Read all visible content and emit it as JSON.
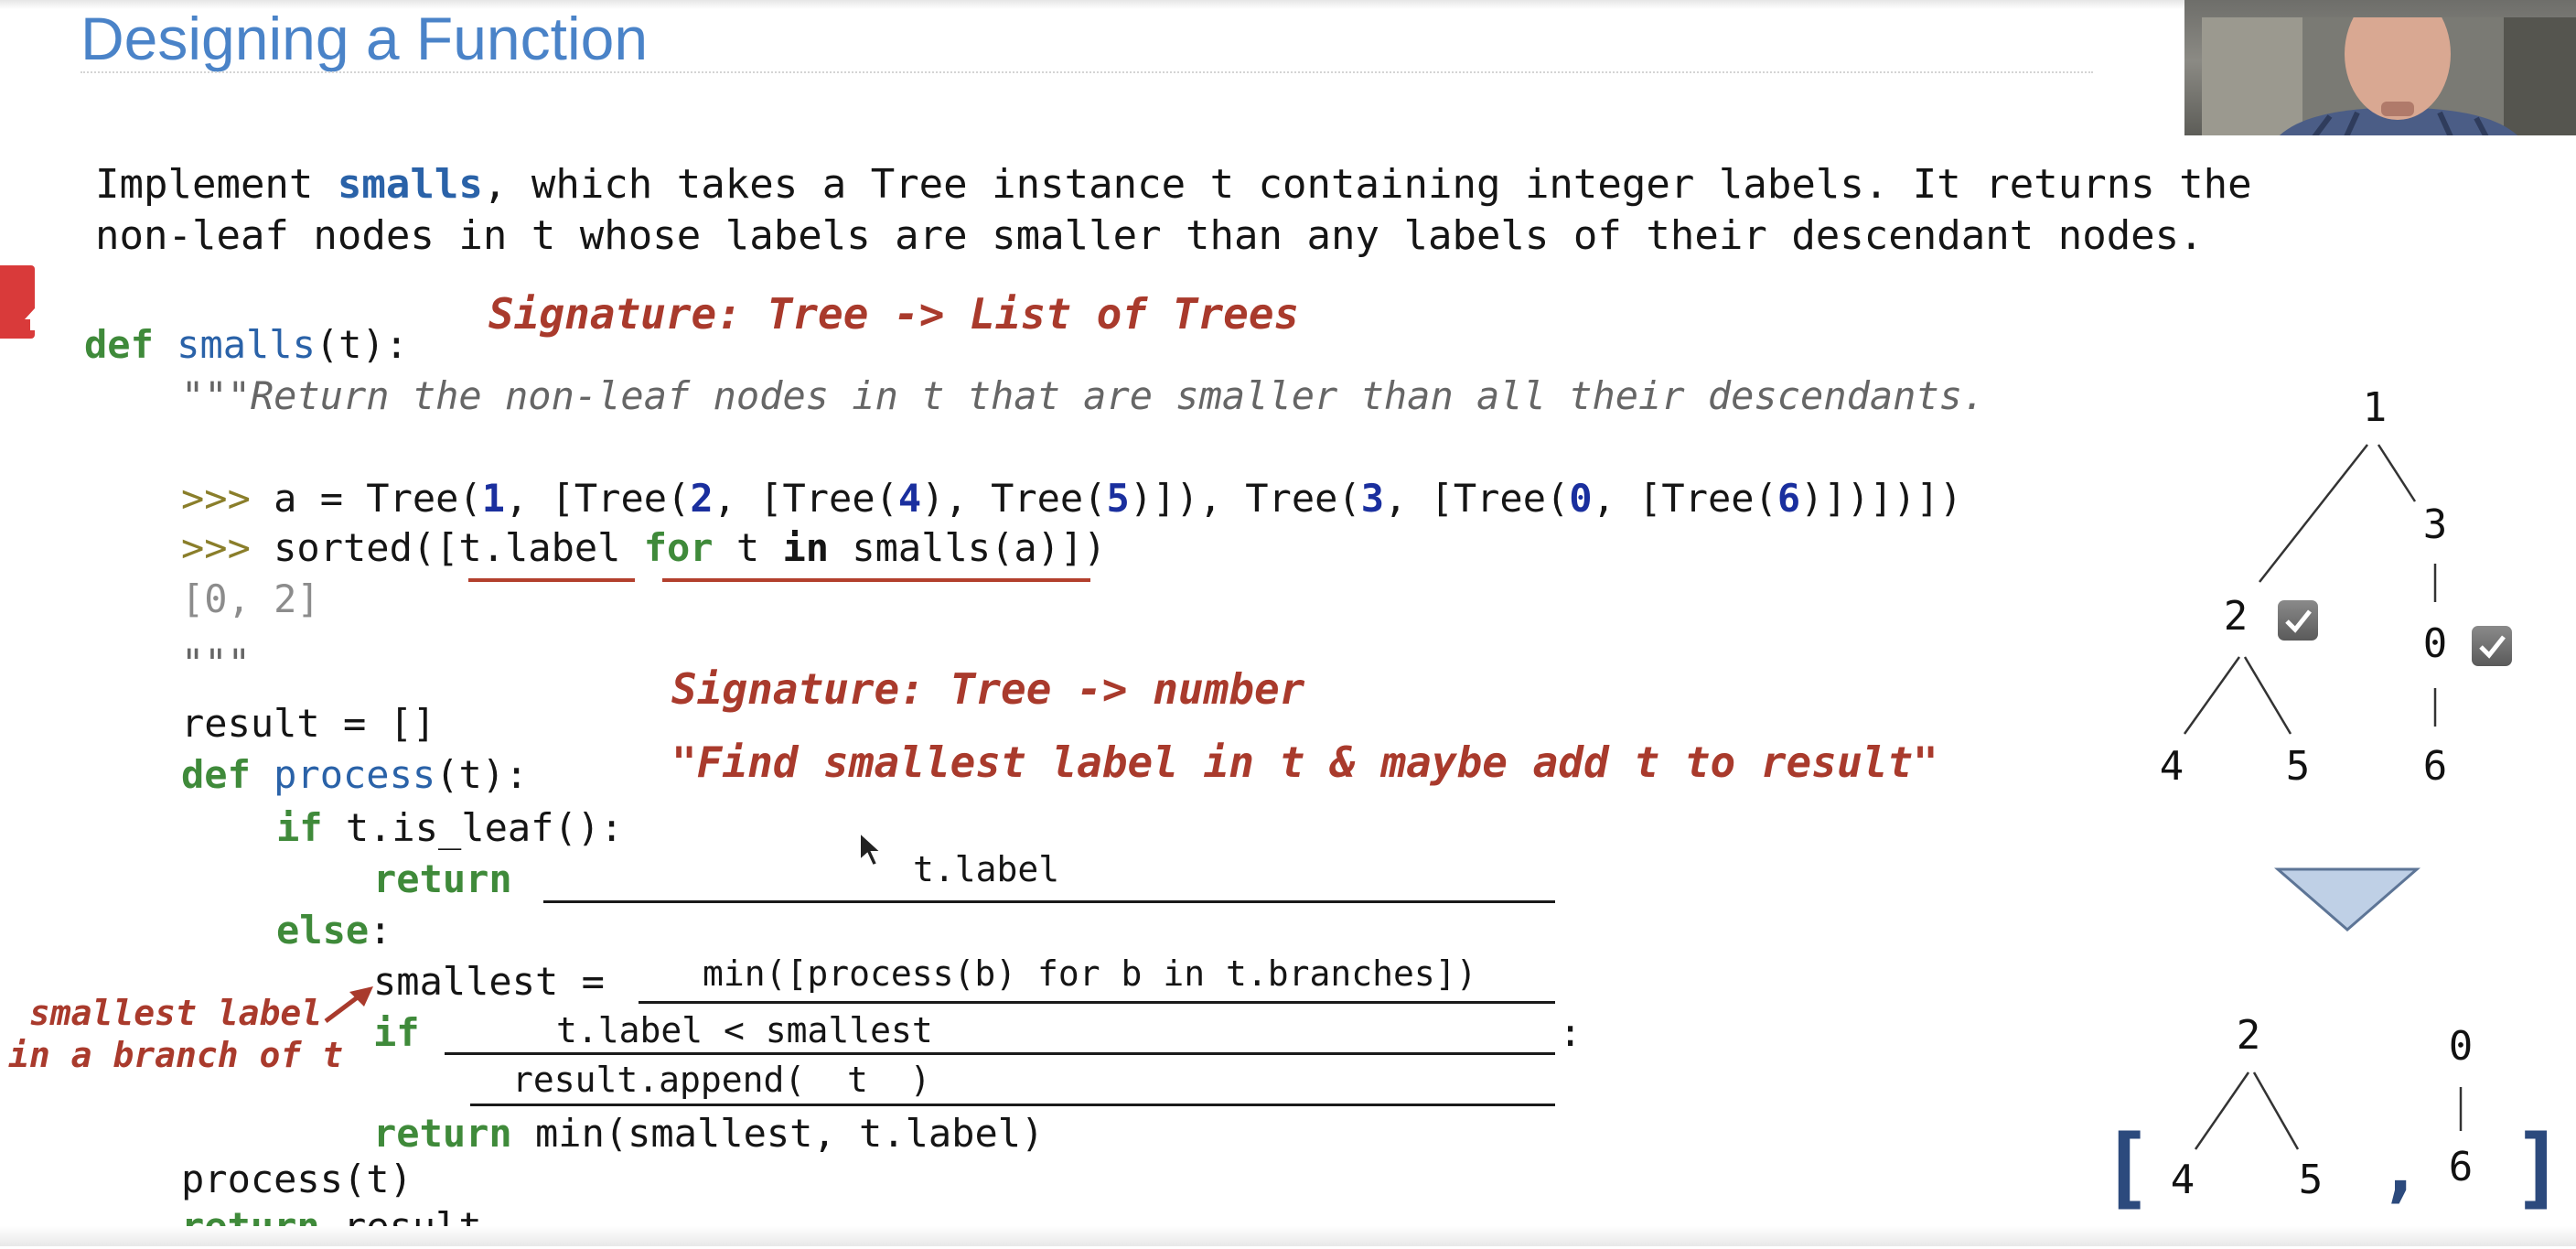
{
  "slide": {
    "title": "Designing a Function"
  },
  "prompt": {
    "line1_pre": "Implement ",
    "line1_fn": "smalls",
    "line1_post": ", which takes a Tree instance t containing integer labels. It returns the",
    "line2": "non-leaf nodes in t whose labels are smaller than any labels of their descendant nodes."
  },
  "annotations": {
    "signature_smalls": "Signature: Tree -> List of Trees",
    "signature_process": "Signature: Tree -> number",
    "process_description": "\"Find smallest label in t & maybe add t to result\"",
    "smallest_note_line1": "smallest label",
    "smallest_note_line2": "in a branch of t"
  },
  "code": {
    "def_kw": "def",
    "smalls_name": "smalls",
    "smalls_sig": "(t):",
    "docstring": "\"\"\"Return the non-leaf nodes in t that are smaller than all their descendants.",
    "doctest1_prompt": ">>>",
    "doctest1_a": " a = Tree(",
    "doctest1_n1": "1",
    "doctest1_b": ", [Tree(",
    "doctest1_n2": "2",
    "doctest1_c": ", [Tree(",
    "doctest1_n4": "4",
    "doctest1_d": "), Tree(",
    "doctest1_n5": "5",
    "doctest1_e": ")]), Tree(",
    "doctest1_n3": "3",
    "doctest1_f": ", [Tree(",
    "doctest1_n0": "0",
    "doctest1_g": ", [Tree(",
    "doctest1_n6": "6",
    "doctest1_h": ")])])])",
    "doctest2_prompt": ">>>",
    "doctest2_a": " sorted([t.label ",
    "doctest2_for": "for",
    "doctest2_b": " t ",
    "doctest2_in": "in",
    "doctest2_c": " smalls(a)])",
    "doctest_output": "[0, 2]",
    "doc_close": "\"\"\"",
    "result_init": "result = []",
    "process_def_kw": "def",
    "process_name": "process",
    "process_sig": "(t):",
    "if_kw": "if",
    "if_leaf": " t.is_leaf():",
    "return_kw": "return",
    "else_kw": "else",
    "else_colon": ":",
    "smallest_assign": "smallest = ",
    "if_kw2": "if",
    "if_colon": ":",
    "return_kw2": "return",
    "return_min": " min(smallest, t.label)",
    "process_call": "process(t)",
    "return_kw3": "return",
    "return_result": " result"
  },
  "blanks": {
    "leaf_return": "t.label",
    "smallest_value": "min([process(b) for b in t.branches])",
    "if_condition": "t.label < smallest",
    "append_stmt": "result.append(  t  )"
  },
  "input_tree": {
    "root": "1",
    "left": "2",
    "right": "3",
    "right_child": "0",
    "left_left": "4",
    "left_right": "5",
    "right_leaf": "6"
  },
  "output_list": {
    "open_bracket": "[",
    "tree1_root": "2",
    "tree1_left": "4",
    "tree1_right": "5",
    "separator": ",",
    "tree2_root": "0",
    "tree2_child": "6",
    "close_bracket": "]"
  },
  "colors": {
    "title": "#4a83c8",
    "keyword": "#3f8a3a",
    "function": "#2a62a8",
    "number": "#1a2f9e",
    "annotation": "#a93a2c"
  },
  "icons": [
    "checkbox-checked-icon",
    "down-triangle-icon",
    "mouse-cursor-icon",
    "arrow-icon"
  ]
}
